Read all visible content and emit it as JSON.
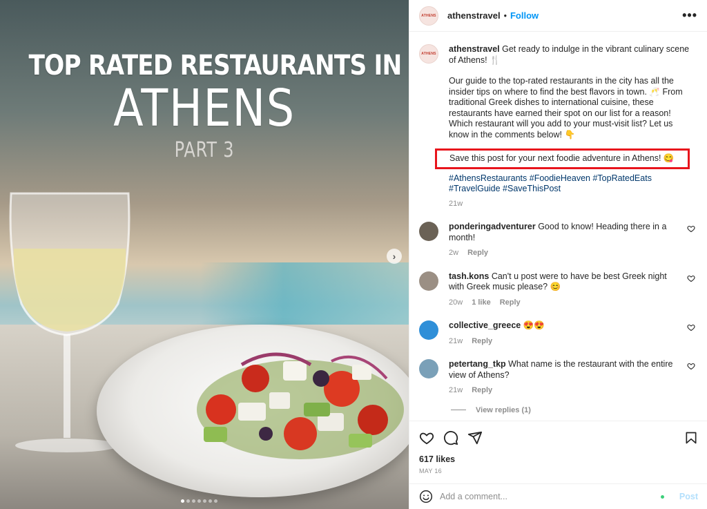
{
  "media": {
    "title_line1": "TOP RATED RESTAURANTS IN",
    "title_line2": "ATHENS",
    "title_line3": "PART 3",
    "carousel_dots": 7,
    "active_dot": 0
  },
  "header": {
    "avatar_text": "ATHENS",
    "username": "athenstravel",
    "separator": "•",
    "follow_label": "Follow",
    "more_icon": "more-horizontal-icon"
  },
  "caption": {
    "avatar_text": "ATHENS",
    "username": "athenstravel",
    "intro": " Get ready to indulge in the vibrant culinary scene of Athens! 🍴",
    "paragraph2": "Our guide to the top-rated restaurants in the city has all the insider tips on where to find the best flavors in town. 🥂 From traditional Greek dishes to international cuisine, these restaurants have earned their spot on our list for a reason! Which restaurant will you add to your must-visit list? Let us know in the comments below! 👇",
    "highlight": "Save this post for your next foodie adventure in Athens! 😋",
    "hashtags": "#AthensRestaurants #FoodieHeaven #TopRatedEats #TravelGuide #SaveThisPost",
    "time": "21w"
  },
  "comments": [
    {
      "username": "ponderingadventurer",
      "text": " Good to know! Heading there in a month!",
      "time": "2w",
      "likes": "",
      "reply": "Reply",
      "avatar_color": "#6b6256"
    },
    {
      "username": "tash.kons",
      "text": " Can't u post were to have be best Greek night with Greek music please? 😊",
      "time": "20w",
      "likes": "1 like",
      "reply": "Reply",
      "avatar_color": "#9b8f84"
    },
    {
      "username": "collective_greece",
      "text": " 😍😍",
      "time": "21w",
      "likes": "",
      "reply": "Reply",
      "avatar_color": "#2f8fd8"
    },
    {
      "username": "petertang_tkp",
      "text": " What name is the restaurant with the entire view of Athens?",
      "time": "21w",
      "likes": "",
      "reply": "Reply",
      "avatar_color": "#7aa0b8"
    }
  ],
  "view_replies": "View replies (1)",
  "actions": {
    "like_icon": "heart-icon",
    "comment_icon": "comment-icon",
    "share_icon": "send-icon",
    "save_icon": "bookmark-icon",
    "likes": "617 likes",
    "date": "MAY 16"
  },
  "add_comment": {
    "emoji_icon": "emoji-icon",
    "placeholder": "Add a comment...",
    "post_label": "Post"
  },
  "colors": {
    "link_blue": "#0095f6",
    "hashtag_blue": "#00376b",
    "highlight_red": "#e8141c",
    "muted": "#8e8e8e"
  }
}
